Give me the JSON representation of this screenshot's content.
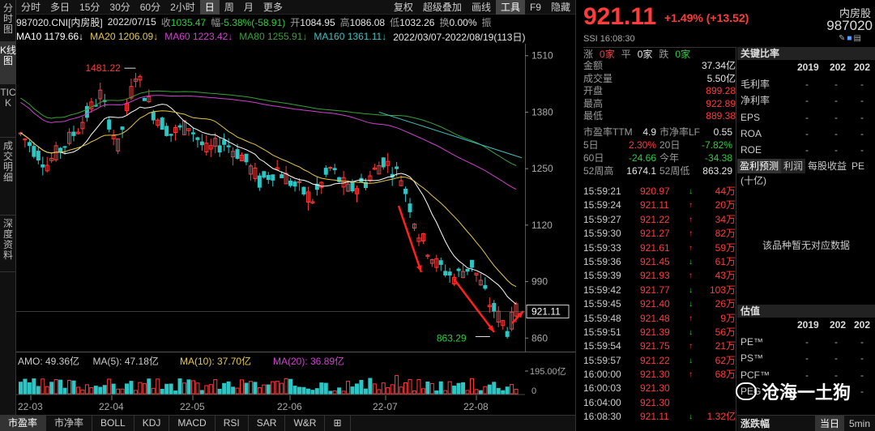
{
  "left_tabs": [
    "分时图",
    "K线图",
    "TICK",
    "成交明细",
    "深度资料"
  ],
  "toolbar": {
    "items": [
      "分时",
      "多日",
      "15分",
      "30分",
      "60分",
      "2小时",
      "日",
      "周",
      "月",
      "更多"
    ],
    "active": "日",
    "right_items": [
      "复权",
      "超级叠加",
      "画线",
      "工具",
      "F9",
      "隐藏"
    ]
  },
  "info": {
    "code": "987020.CNI[内房股]",
    "date": "2022/07/15",
    "close_label": "收",
    "close": "1035.47",
    "chg_label": "幅",
    "chg": "-5.38%(-58.91)",
    "open_label": "开",
    "open": "1084.95",
    "high_label": "高",
    "high": "1086.08",
    "low_label": "低",
    "low": "1032.26",
    "turn_label": "换",
    "turn": "0.00%",
    "amp_label": "振"
  },
  "ma": {
    "ma10": "MA10 1179.66↓",
    "ma20": "MA20 1206.09↓",
    "ma60": "MA60 1223.42↓",
    "ma80": "MA80 1255.91↓",
    "ma160": "MA160 1361.11↓",
    "range": "2022/03/07-2022/08/19(113日)"
  },
  "chart_data": {
    "type": "candlestick",
    "y_ticks": [
      "1510",
      "1380",
      "1250",
      "1120",
      "990",
      "860"
    ],
    "ylim": [
      840,
      1530
    ],
    "x_ticks": [
      "22-03",
      "22-04",
      "22-05",
      "22-06",
      "22-07",
      "22-08"
    ],
    "annotations": {
      "high": "1481.22",
      "low": "863.29",
      "current": "921.11"
    },
    "volume": {
      "amo": "AMO: 49.36亿",
      "ma5": "MA(5): 47.18亿",
      "ma10": "MA(10): 37.70亿",
      "ma20": "MA(20): 36.89亿",
      "y_ticks": [
        "195.00亿",
        "0"
      ]
    },
    "colors": {
      "up": "#ff3b3b",
      "down": "#2ec5c5",
      "ma10": "#ffffff",
      "ma20": "#e6c84a",
      "ma60": "#d040d0",
      "ma80": "#3aa03a",
      "ma160": "#40c0c0",
      "arrow": "#ff2020"
    }
  },
  "bottom_tabs": [
    "市盈率",
    "市净率",
    "BOLL",
    "KDJ",
    "MACD",
    "RSI",
    "SAR",
    "W&R",
    "⊞"
  ],
  "quote": {
    "price": "921.11",
    "change": "+1.49% (+13.52)",
    "name": "内房股",
    "code": "987020",
    "sub": "SSI 16:08:30",
    "up_label": "涨",
    "up_count": "0家",
    "flat_label": "平",
    "flat_count": "0家",
    "down_label": "跌",
    "down_count": "0家"
  },
  "stats": [
    {
      "k": "金额",
      "v": "37.34亿",
      "c": "white"
    },
    {
      "k": "成交量",
      "v": "5.50亿",
      "c": "white"
    },
    {
      "k": "开盘",
      "v": "899.28",
      "c": "red"
    },
    {
      "k": "最高",
      "v": "922.89",
      "c": "red"
    },
    {
      "k": "最低",
      "v": "889.38",
      "c": "red"
    }
  ],
  "stats2": [
    [
      {
        "k": "市盈率TTM",
        "v": "4.9",
        "c": "white"
      },
      {
        "k": "市净率LF",
        "v": "0.55",
        "c": "white"
      }
    ],
    [
      {
        "k": "5日",
        "v": "2.30%",
        "c": "red"
      },
      {
        "k": "20日",
        "v": "-7.82%",
        "c": "green"
      }
    ],
    [
      {
        "k": "60日",
        "v": "-24.66",
        "c": "green"
      },
      {
        "k": "今年",
        "v": "-34.38",
        "c": "green"
      }
    ],
    [
      {
        "k": "52周高",
        "v": "1674.1",
        "c": "white"
      },
      {
        "k": "52周低",
        "v": "863.29",
        "c": "white"
      }
    ]
  ],
  "ticks": [
    {
      "t": "15:59:21",
      "p": "920.97",
      "a": "↓",
      "ac": "green",
      "v": "44万",
      "vc": "red"
    },
    {
      "t": "15:59:24",
      "p": "921.11",
      "a": "↑",
      "ac": "red",
      "v": "20万",
      "vc": "red"
    },
    {
      "t": "15:59:27",
      "p": "921.22",
      "a": "↑",
      "ac": "red",
      "v": "34万",
      "vc": "red"
    },
    {
      "t": "15:59:30",
      "p": "921.27",
      "a": "↑",
      "ac": "red",
      "v": "82万",
      "vc": "red"
    },
    {
      "t": "15:59:33",
      "p": "921.61",
      "a": "↑",
      "ac": "red",
      "v": "59万",
      "vc": "red"
    },
    {
      "t": "15:59:36",
      "p": "921.45",
      "a": "↓",
      "ac": "green",
      "v": "61万",
      "vc": "red"
    },
    {
      "t": "15:59:39",
      "p": "921.93",
      "a": "↑",
      "ac": "red",
      "v": "43万",
      "vc": "red"
    },
    {
      "t": "15:59:42",
      "p": "921.77",
      "a": "↓",
      "ac": "green",
      "v": "103万",
      "vc": "red"
    },
    {
      "t": "15:59:45",
      "p": "921.40",
      "a": "↓",
      "ac": "green",
      "v": "26万",
      "vc": "red"
    },
    {
      "t": "15:59:48",
      "p": "921.48",
      "a": "↑",
      "ac": "red",
      "v": "9万",
      "vc": "red"
    },
    {
      "t": "15:59:51",
      "p": "921.39",
      "a": "↓",
      "ac": "green",
      "v": "56万",
      "vc": "red"
    },
    {
      "t": "15:59:54",
      "p": "921.75",
      "a": "↑",
      "ac": "red",
      "v": "21万",
      "vc": "red"
    },
    {
      "t": "15:59:57",
      "p": "921.22",
      "a": "↓",
      "ac": "green",
      "v": "62万",
      "vc": "red"
    },
    {
      "t": "16:00:00",
      "p": "921.30",
      "a": "↑",
      "ac": "red",
      "v": "68万",
      "vc": "red"
    },
    {
      "t": "16:00:03",
      "p": "921.30",
      "a": "",
      "ac": "red",
      "v": "",
      "vc": "red"
    },
    {
      "t": "16:04:00",
      "p": "921.30",
      "a": "",
      "ac": "red",
      "v": "",
      "vc": "red"
    },
    {
      "t": "16:08:30",
      "p": "921.11",
      "a": "↓",
      "ac": "green",
      "v": "1.32亿",
      "vc": "red"
    }
  ],
  "ratios": {
    "title": "关键比率",
    "years": [
      "2019",
      "202",
      "202"
    ],
    "rows": [
      "毛利率",
      "净利率",
      "EPS",
      "ROA",
      "ROE"
    ],
    "dash": "-"
  },
  "forecast": {
    "tabs": [
      "盈利预测",
      "利润",
      "每股收益",
      "PE"
    ],
    "sub": "(十亿)",
    "no_data": "该品种暂无对应数据"
  },
  "valuation": {
    "title": "估值",
    "years": [
      "2019",
      "202",
      "202"
    ],
    "rows": [
      "PE™",
      "PS™",
      "PCF™",
      "PEG"
    ],
    "dash": "-"
  },
  "watermark": "沧海一土狗",
  "zf": {
    "title": "涨跌幅",
    "btn1": "当日",
    "btn2": "5min"
  }
}
